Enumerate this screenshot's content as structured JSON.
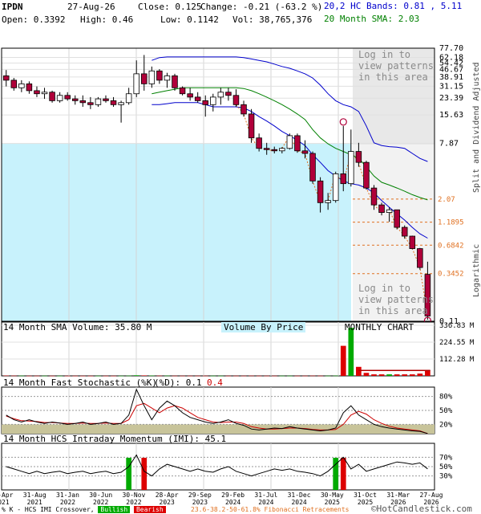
{
  "header": {
    "ticker": "IPDN",
    "date": "27-Aug-26",
    "close_label": "Close: 0.125",
    "change_label": "Change: -0.21 (-63.2 %)",
    "open_label": "Open: 0.3392",
    "high_label": "High: 0.46",
    "low_label": "Low: 0.1142",
    "vol_label": "Vol: 38,765,376",
    "bands_label": "20,2 HC Bands: 0.81 , 5.11",
    "sma_label": "20 Month SMA: 2.03"
  },
  "main_panel": {
    "watermark_top": [
      "Log in to",
      "view patterns",
      "in this area"
    ],
    "watermark_bottom": [
      "Log in to",
      "view patterns",
      "in this area"
    ],
    "side_label_top": "Split and Dividend Adjusted",
    "side_label_bottom": "Logarithmic"
  },
  "volume_panel": {
    "title": "14 Month SMA Volume: 35.80 M",
    "vbp_label": "Volume By Price",
    "chart_label": "MONTHLY CHART",
    "axis": [
      "336.83 M",
      "224.55 M",
      "112.28 M"
    ]
  },
  "stoch_panel": {
    "title": "14 Month Fast Stochastic (%K)",
    "d_label": "(%D): 0.1",
    "k_value": "0.4",
    "axis": [
      "80%",
      "50%",
      "20%"
    ]
  },
  "imi_panel": {
    "title": "14 Month HCS Intraday Momentum (IMI): 45.1",
    "axis": [
      "70%",
      "50%",
      "30%"
    ]
  },
  "footer": {
    "legend_prefix": "% K - HCS IMI Crossover,",
    "bullish": "Bullish",
    "bearish": "Bearish",
    "fib": "23.6-38.2-50-61.8% Fibonacci Retracements",
    "copyright": "©HotCandlestick.com"
  },
  "chart_data": {
    "type": "candlestick",
    "scale": "log",
    "ylim": [
      0.11,
      77.7
    ],
    "y_ticks": [
      "77.70",
      "62.18",
      "54.42",
      "46.67",
      "38.91",
      "31.15",
      "23.39",
      "15.63",
      "7.87",
      "0.11"
    ],
    "fib_levels": [
      2.07,
      1.1895,
      0.6842,
      0.3452
    ],
    "x_tick_labels": [
      [
        "30-Apr",
        "2021"
      ],
      [
        "31-Aug",
        "2021"
      ],
      [
        "31-Jan",
        "2022"
      ],
      [
        "30-Jun",
        "2022"
      ],
      [
        "30-Nov",
        "2022"
      ],
      [
        "28-Apr",
        "2023"
      ],
      [
        "29-Sep",
        "2023"
      ],
      [
        "29-Feb",
        "2024"
      ],
      [
        "31-Jul",
        "2024"
      ],
      [
        "31-Dec",
        "2024"
      ],
      [
        "30-May",
        "2025"
      ],
      [
        "31-Oct",
        "2025"
      ],
      [
        "31-Mar",
        "2026"
      ],
      [
        "27-Aug",
        "2026"
      ]
    ],
    "candles": [
      {
        "o": 40,
        "h": 46,
        "l": 31,
        "c": 36
      },
      {
        "o": 36,
        "h": 38,
        "l": 28,
        "c": 30
      },
      {
        "o": 30,
        "h": 36,
        "l": 27,
        "c": 33
      },
      {
        "o": 33,
        "h": 35,
        "l": 26,
        "c": 28
      },
      {
        "o": 28,
        "h": 31,
        "l": 24,
        "c": 26
      },
      {
        "o": 26,
        "h": 30,
        "l": 23,
        "c": 27
      },
      {
        "o": 27,
        "h": 28,
        "l": 21,
        "c": 22
      },
      {
        "o": 22,
        "h": 27,
        "l": 21,
        "c": 25
      },
      {
        "o": 25,
        "h": 27,
        "l": 22,
        "c": 23
      },
      {
        "o": 23,
        "h": 25,
        "l": 20,
        "c": 22
      },
      {
        "o": 22,
        "h": 25,
        "l": 19,
        "c": 21
      },
      {
        "o": 21,
        "h": 24,
        "l": 18,
        "c": 20
      },
      {
        "o": 20,
        "h": 24,
        "l": 19,
        "c": 23
      },
      {
        "o": 23,
        "h": 25,
        "l": 21,
        "c": 22
      },
      {
        "o": 22,
        "h": 24,
        "l": 19,
        "c": 20
      },
      {
        "o": 20,
        "h": 22,
        "l": 13,
        "c": 21
      },
      {
        "o": 21,
        "h": 30,
        "l": 20,
        "c": 26
      },
      {
        "o": 26,
        "h": 58,
        "l": 24,
        "c": 42
      },
      {
        "o": 42,
        "h": 66,
        "l": 28,
        "c": 33
      },
      {
        "o": 33,
        "h": 50,
        "l": 30,
        "c": 45
      },
      {
        "o": 45,
        "h": 47,
        "l": 33,
        "c": 36
      },
      {
        "o": 36,
        "h": 43,
        "l": 30,
        "c": 40
      },
      {
        "o": 40,
        "h": 42,
        "l": 28,
        "c": 30
      },
      {
        "o": 30,
        "h": 31,
        "l": 25,
        "c": 26
      },
      {
        "o": 26,
        "h": 30,
        "l": 22,
        "c": 24
      },
      {
        "o": 24,
        "h": 27,
        "l": 21,
        "c": 22
      },
      {
        "o": 22,
        "h": 25,
        "l": 15,
        "c": 20
      },
      {
        "o": 20,
        "h": 26,
        "l": 17,
        "c": 24
      },
      {
        "o": 24,
        "h": 30,
        "l": 20,
        "c": 27
      },
      {
        "o": 27,
        "h": 30,
        "l": 22,
        "c": 25
      },
      {
        "o": 25,
        "h": 29,
        "l": 19,
        "c": 20
      },
      {
        "o": 20,
        "h": 22,
        "l": 15,
        "c": 16
      },
      {
        "o": 16,
        "h": 18,
        "l": 8,
        "c": 9
      },
      {
        "o": 9,
        "h": 10,
        "l": 6.5,
        "c": 7
      },
      {
        "o": 7,
        "h": 8,
        "l": 6,
        "c": 6.8
      },
      {
        "o": 6.8,
        "h": 7.3,
        "l": 6.2,
        "c": 6.6
      },
      {
        "o": 6.6,
        "h": 7.2,
        "l": 6.2,
        "c": 7.0
      },
      {
        "o": 7.0,
        "h": 10,
        "l": 6.8,
        "c": 9.5
      },
      {
        "o": 9.5,
        "h": 10,
        "l": 6.3,
        "c": 6.6
      },
      {
        "o": 6.6,
        "h": 8.5,
        "l": 5.5,
        "c": 6.2
      },
      {
        "o": 6.2,
        "h": 6.5,
        "l": 3.0,
        "c": 3.2
      },
      {
        "o": 3.2,
        "h": 3.5,
        "l": 1.5,
        "c": 1.9
      },
      {
        "o": 1.9,
        "h": 2.4,
        "l": 1.6,
        "c": 2.0
      },
      {
        "o": 2.0,
        "h": 4.0,
        "l": 1.9,
        "c": 3.8
      },
      {
        "o": 3.8,
        "h": 12,
        "l": 2.5,
        "c": 3.0
      },
      {
        "o": 3.0,
        "h": 11,
        "l": 2.8,
        "c": 6.5
      },
      {
        "o": 6.5,
        "h": 8,
        "l": 4.5,
        "c": 5.0
      },
      {
        "o": 5.0,
        "h": 5.2,
        "l": 2.6,
        "c": 2.7
      },
      {
        "o": 2.7,
        "h": 2.9,
        "l": 1.6,
        "c": 1.8
      },
      {
        "o": 1.8,
        "h": 1.9,
        "l": 1.4,
        "c": 1.5
      },
      {
        "o": 1.5,
        "h": 1.7,
        "l": 1.2,
        "c": 1.6
      },
      {
        "o": 1.6,
        "h": 1.6,
        "l": 1.0,
        "c": 1.05
      },
      {
        "o": 1.05,
        "h": 1.1,
        "l": 0.8,
        "c": 0.85
      },
      {
        "o": 0.85,
        "h": 0.86,
        "l": 0.62,
        "c": 0.63
      },
      {
        "o": 0.63,
        "h": 0.64,
        "l": 0.38,
        "c": 0.4
      },
      {
        "o": 0.3392,
        "h": 0.46,
        "l": 0.1142,
        "c": 0.125
      }
    ],
    "bb_upper": [
      null,
      null,
      null,
      null,
      null,
      null,
      null,
      null,
      null,
      null,
      null,
      null,
      null,
      null,
      null,
      null,
      null,
      null,
      null,
      58,
      62,
      63,
      63,
      63,
      63,
      63,
      63,
      63,
      63,
      63,
      63,
      62,
      60,
      58,
      56,
      53,
      50,
      48,
      45,
      42,
      38,
      32,
      26,
      22,
      20,
      19,
      17,
      12,
      8,
      7.5,
      7.3,
      7.2,
      7.0,
      6.2,
      5.5,
      5.11
    ],
    "bb_lower": [
      null,
      null,
      null,
      null,
      null,
      null,
      null,
      null,
      null,
      null,
      null,
      null,
      null,
      null,
      null,
      null,
      null,
      null,
      null,
      20,
      20,
      20.5,
      21,
      21,
      21,
      21,
      20,
      19,
      19,
      19,
      19,
      18.5,
      17,
      15,
      13.5,
      12,
      10.5,
      9.5,
      8.5,
      7.5,
      6,
      5,
      4.1,
      3.6,
      3.2,
      3,
      2.9,
      2.7,
      2.4,
      2,
      1.7,
      1.45,
      1.25,
      1.05,
      0.9,
      0.81
    ],
    "sma20": [
      null,
      null,
      null,
      null,
      null,
      null,
      null,
      null,
      null,
      null,
      null,
      null,
      null,
      null,
      null,
      null,
      null,
      null,
      null,
      26,
      27,
      28,
      29,
      30,
      30,
      30,
      30,
      30,
      30,
      30,
      30,
      29.5,
      28,
      26,
      24,
      22,
      20,
      18,
      16,
      14,
      11,
      9,
      7.8,
      7,
      6.5,
      6,
      5.5,
      4.5,
      3.6,
      3.1,
      2.9,
      2.7,
      2.5,
      2.3,
      2.15,
      2.03
    ],
    "volume": [
      2,
      1.5,
      1.5,
      1,
      1,
      1,
      1,
      0.8,
      0.8,
      0.8,
      0.8,
      0.8,
      0.8,
      0.8,
      0.8,
      0.8,
      1.5,
      4,
      3,
      2,
      1.5,
      1.5,
      1,
      1,
      1,
      1,
      1,
      1,
      1,
      1,
      1,
      1,
      1.5,
      1,
      1,
      1,
      1,
      1,
      1,
      1,
      1.5,
      1.2,
      1,
      1.5,
      200,
      320,
      60,
      20,
      10,
      10,
      10,
      10,
      10,
      10,
      15,
      35
    ],
    "stoch_k": [
      40,
      30,
      25,
      30,
      25,
      22,
      25,
      23,
      20,
      22,
      25,
      20,
      22,
      25,
      20,
      22,
      40,
      95,
      60,
      30,
      55,
      70,
      60,
      45,
      35,
      30,
      25,
      22,
      25,
      30,
      22,
      18,
      10,
      8,
      10,
      12,
      11,
      15,
      12,
      10,
      8,
      6,
      8,
      12,
      45,
      60,
      40,
      30,
      20,
      15,
      12,
      10,
      8,
      6,
      5,
      0.4
    ],
    "stoch_d": [
      38,
      32,
      28,
      27,
      26,
      24,
      24,
      23,
      22,
      22,
      23,
      22,
      22,
      23,
      22,
      22,
      30,
      60,
      65,
      55,
      45,
      55,
      60,
      55,
      45,
      35,
      30,
      25,
      24,
      25,
      25,
      22,
      15,
      12,
      10,
      10,
      11,
      12,
      12,
      11,
      9,
      8,
      8,
      9,
      20,
      40,
      48,
      42,
      30,
      22,
      16,
      12,
      10,
      8,
      6,
      0.1
    ],
    "imi": [
      50,
      45,
      40,
      35,
      40,
      35,
      38,
      40,
      35,
      38,
      40,
      35,
      38,
      40,
      35,
      38,
      50,
      75,
      40,
      30,
      45,
      55,
      50,
      45,
      40,
      45,
      40,
      38,
      45,
      50,
      40,
      35,
      30,
      35,
      40,
      45,
      42,
      45,
      40,
      38,
      35,
      30,
      40,
      55,
      70,
      45,
      55,
      40,
      45,
      50,
      55,
      60,
      58,
      55,
      58,
      45.1
    ],
    "bullish_idx": [
      16,
      43
    ],
    "bearish_idx": [
      18,
      44
    ]
  }
}
